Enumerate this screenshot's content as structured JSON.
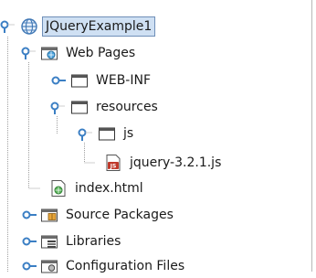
{
  "tree": {
    "project": {
      "label": "JQueryExample1",
      "icon": "globe-project-icon",
      "expanded": true
    },
    "web_pages": {
      "label": "Web Pages",
      "icon": "web-pages-folder-icon",
      "expanded": true
    },
    "web_inf": {
      "label": "WEB-INF",
      "icon": "folder-icon",
      "expanded": false
    },
    "resources": {
      "label": "resources",
      "icon": "folder-icon",
      "expanded": true
    },
    "js": {
      "label": "js",
      "icon": "folder-icon",
      "expanded": true
    },
    "jquery": {
      "label": "jquery-3.2.1.js",
      "icon": "js-file-icon"
    },
    "index": {
      "label": "index.html",
      "icon": "html-file-icon"
    },
    "source_packages": {
      "label": "Source Packages",
      "icon": "source-packages-icon",
      "expanded": false
    },
    "libraries": {
      "label": "Libraries",
      "icon": "libraries-icon",
      "expanded": false
    },
    "config_files": {
      "label": "Configuration Files",
      "icon": "config-files-icon",
      "expanded": false
    }
  },
  "colors": {
    "selection_bg": "#cfe0f3",
    "selection_border": "#6f8fb8",
    "toggle_blue": "#3b7fc4",
    "tree_line": "#a0a0a0",
    "js_red": "#c0392b"
  }
}
